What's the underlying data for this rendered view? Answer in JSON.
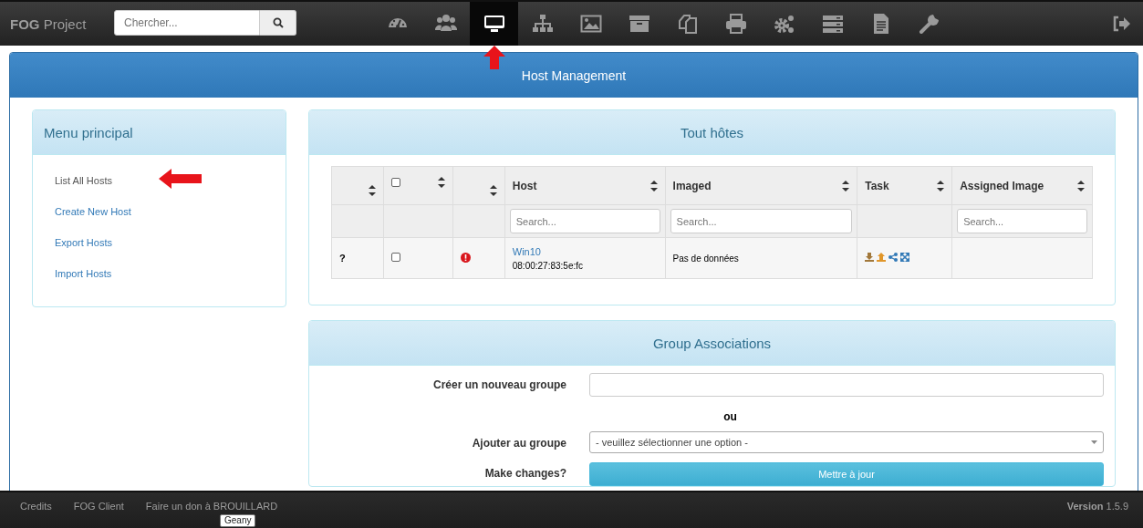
{
  "navbar": {
    "brand_bold": "FOG",
    "brand": "Project",
    "search": {
      "placeholder": "Chercher..."
    },
    "items": [
      {
        "selected": false
      },
      {
        "selected": false
      },
      {
        "selected": true
      },
      {
        "selected": false
      },
      {
        "selected": false
      },
      {
        "selected": false
      },
      {
        "selected": false
      },
      {
        "selected": false
      },
      {
        "selected": false
      },
      {
        "selected": false
      },
      {
        "selected": false
      },
      {
        "selected": false
      }
    ]
  },
  "page": {
    "title": "Host Management"
  },
  "sidebar": {
    "title": "Menu principal",
    "items": [
      {
        "label": "List All Hosts",
        "selected": true
      },
      {
        "label": "Create New Host",
        "selected": false
      },
      {
        "label": "Export Hosts",
        "selected": false
      },
      {
        "label": "Import Hosts",
        "selected": false
      }
    ]
  },
  "hosts": {
    "title": "Tout hôtes",
    "columns": [
      {
        "kind": "status"
      },
      {
        "kind": "select",
        "checked": false
      },
      {
        "kind": "alert"
      },
      {
        "kind": "text",
        "label": "Host",
        "placeholder": "Search..."
      },
      {
        "kind": "text",
        "label": "Imaged",
        "placeholder": "Search..."
      },
      {
        "kind": "text",
        "label": "Task"
      },
      {
        "kind": "text",
        "label": "Assigned Image",
        "placeholder": "Search..."
      }
    ],
    "rows": [
      {
        "status": "?",
        "checked": false,
        "alert": true,
        "host": "Win10",
        "mac": "08:00:27:83:5e:fc",
        "imaged": "Pas de données"
      }
    ]
  },
  "groups": {
    "title": "Group Associations",
    "new_group_label": "Créer un nouveau groupe",
    "or": "ou",
    "add_label": "Ajouter au groupe",
    "add_value": "- veuillez sélectionner une option -",
    "changes_label": "Make changes?",
    "button": "Mettre à jour"
  },
  "footer": {
    "links": [
      "Credits",
      "FOG Client",
      "Faire un don à BROUILLARD"
    ],
    "version_label": "Version",
    "version": "1.5.9",
    "tooltip": "Geany"
  }
}
